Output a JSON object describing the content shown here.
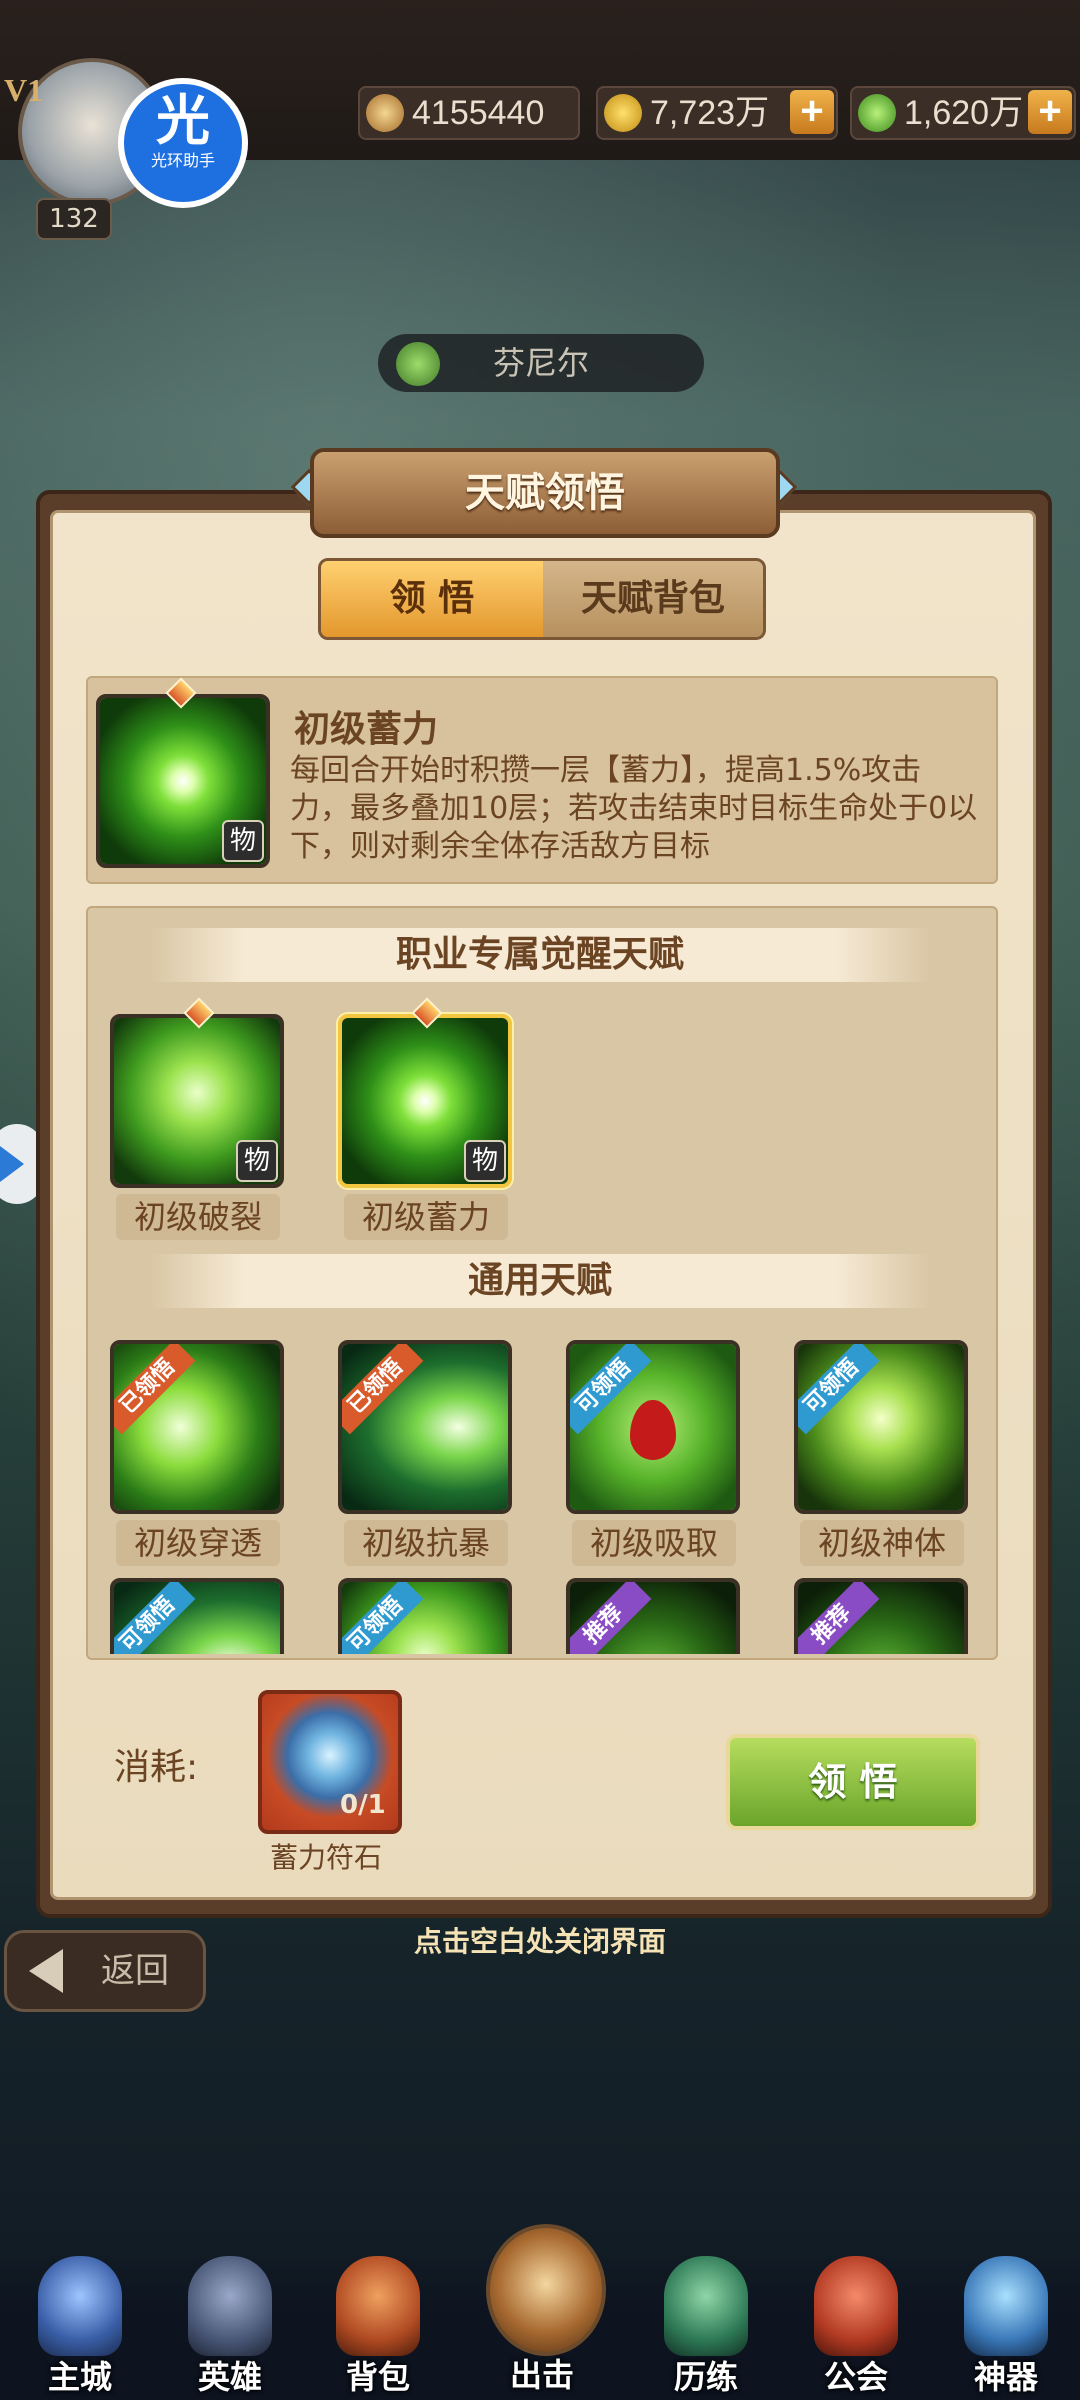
{
  "header": {
    "vip": "V1",
    "player_level": "132",
    "assistant": {
      "char": "光",
      "label": "光环助手"
    },
    "power": "4155440",
    "gold": "7,723万",
    "elixir": "1,620万"
  },
  "hero": {
    "name": "芬尼尔"
  },
  "dialog": {
    "title": "天赋领悟",
    "tabs": [
      {
        "label": "领 悟",
        "active": true
      },
      {
        "label": "天赋背包",
        "active": false
      }
    ],
    "selected": {
      "name": "初级蓄力",
      "tag": "物",
      "description": "每回合开始时积攒一层【蓄力】，提高1.5%攻击力，最多叠加10层；若攻击结束时目标生命处于0以下，则对剩余全体存活敌方目标"
    },
    "sections": [
      {
        "title": "职业专属觉醒天赋",
        "items": [
          {
            "name": "初级破裂",
            "tag": "物",
            "icon": "shield-break-icon",
            "selected": false
          },
          {
            "name": "初级蓄力",
            "tag": "物",
            "icon": "charge-orb-icon",
            "selected": true
          }
        ]
      },
      {
        "title": "通用天赋",
        "items": [
          {
            "name": "初级穿透",
            "badge": "已领悟",
            "icon": "pierce-icon"
          },
          {
            "name": "初级抗暴",
            "badge": "已领悟",
            "icon": "crit-resist-icon"
          },
          {
            "name": "初级吸取",
            "badge": "可领悟",
            "icon": "blood-drop-icon"
          },
          {
            "name": "初级神体",
            "badge": "可领悟",
            "icon": "divine-body-icon"
          },
          {
            "name": "",
            "badge": "可领悟",
            "icon": "leaf-icon"
          },
          {
            "name": "",
            "badge": "可领悟",
            "icon": "shield-icon"
          },
          {
            "name": "",
            "badge": "推荐",
            "icon": "sword-icon"
          },
          {
            "name": "",
            "badge": "推荐",
            "icon": "shadow-icon"
          }
        ]
      }
    ],
    "cost": {
      "label": "消耗:",
      "item_name": "蓄力符石",
      "count": "0/1"
    },
    "action_label": "领 悟"
  },
  "close_hint": "点击空白处关闭界面",
  "back_label": "返回",
  "nav": [
    {
      "label": "主城",
      "icon": "castle-icon"
    },
    {
      "label": "英雄",
      "icon": "helmet-icon"
    },
    {
      "label": "背包",
      "icon": "backpack-icon"
    },
    {
      "label": "出击",
      "icon": "crossed-swords-icon"
    },
    {
      "label": "历练",
      "icon": "training-icon"
    },
    {
      "label": "公会",
      "icon": "guild-icon"
    },
    {
      "label": "神器",
      "icon": "artifact-icon"
    }
  ],
  "colors": {
    "accent": "#e3972d",
    "text_brown": "#6b4423",
    "action_green": "#6aa52a",
    "badge_done": "#d95a2a",
    "badge_can": "#2f9ad0",
    "badge_recommend": "#8a4cc4"
  }
}
